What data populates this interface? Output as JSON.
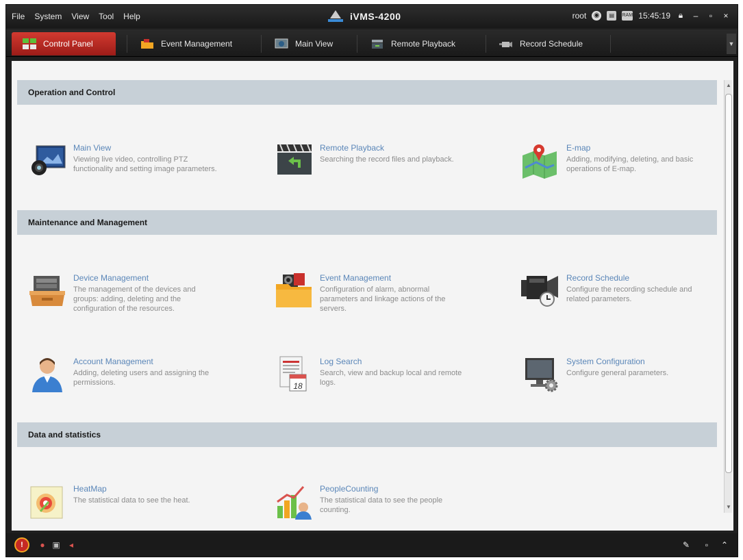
{
  "menu": [
    "File",
    "System",
    "View",
    "Tool",
    "Help"
  ],
  "app_title": "iVMS-4200",
  "status": {
    "user": "root",
    "time": "15:45:19",
    "ram_label": "RAM"
  },
  "tabs": [
    {
      "label": "Control Panel",
      "icon": "control-panel-icon",
      "active": true
    },
    {
      "label": "Event Management",
      "icon": "event-folder-icon",
      "active": false
    },
    {
      "label": "Main View",
      "icon": "main-view-icon",
      "active": false
    },
    {
      "label": "Remote Playback",
      "icon": "playback-icon",
      "active": false
    },
    {
      "label": "Record Schedule",
      "icon": "record-schedule-icon",
      "active": false
    }
  ],
  "sections": {
    "operation": {
      "header": "Operation and Control"
    },
    "maintenance": {
      "header": "Maintenance and Management"
    },
    "data": {
      "header": "Data and statistics"
    }
  },
  "items": {
    "main_view": {
      "title": "Main View",
      "desc": "Viewing live video, controlling PTZ functionality and setting image parameters."
    },
    "remote_playback": {
      "title": "Remote Playback",
      "desc": "Searching the record files and playback."
    },
    "emap": {
      "title": "E-map",
      "desc": "Adding, modifying, deleting, and basic operations of E-map."
    },
    "device_management": {
      "title": "Device Management",
      "desc": "The management of the devices and groups: adding, deleting and the configuration of the resources."
    },
    "event_management": {
      "title": "Event Management",
      "desc": "Configuration of alarm, abnormal parameters and linkage actions of the servers."
    },
    "record_schedule": {
      "title": "Record Schedule",
      "desc": "Configure the recording schedule and related parameters."
    },
    "account_management": {
      "title": "Account Management",
      "desc": "Adding, deleting users and assigning the permissions."
    },
    "log_search": {
      "title": "Log Search",
      "desc": "Search, view and backup local and remote logs.",
      "calendar_day": "18"
    },
    "system_configuration": {
      "title": "System Configuration",
      "desc": "Configure general parameters."
    },
    "heatmap": {
      "title": "HeatMap",
      "desc": "The statistical data to see the heat."
    },
    "people_counting": {
      "title": "PeopleCounting",
      "desc": "The statistical data to see the people counting."
    }
  },
  "colors": {
    "accent": "#c62a24",
    "section_bg": "#c7d0d7",
    "item_title": "#5a86b8"
  }
}
